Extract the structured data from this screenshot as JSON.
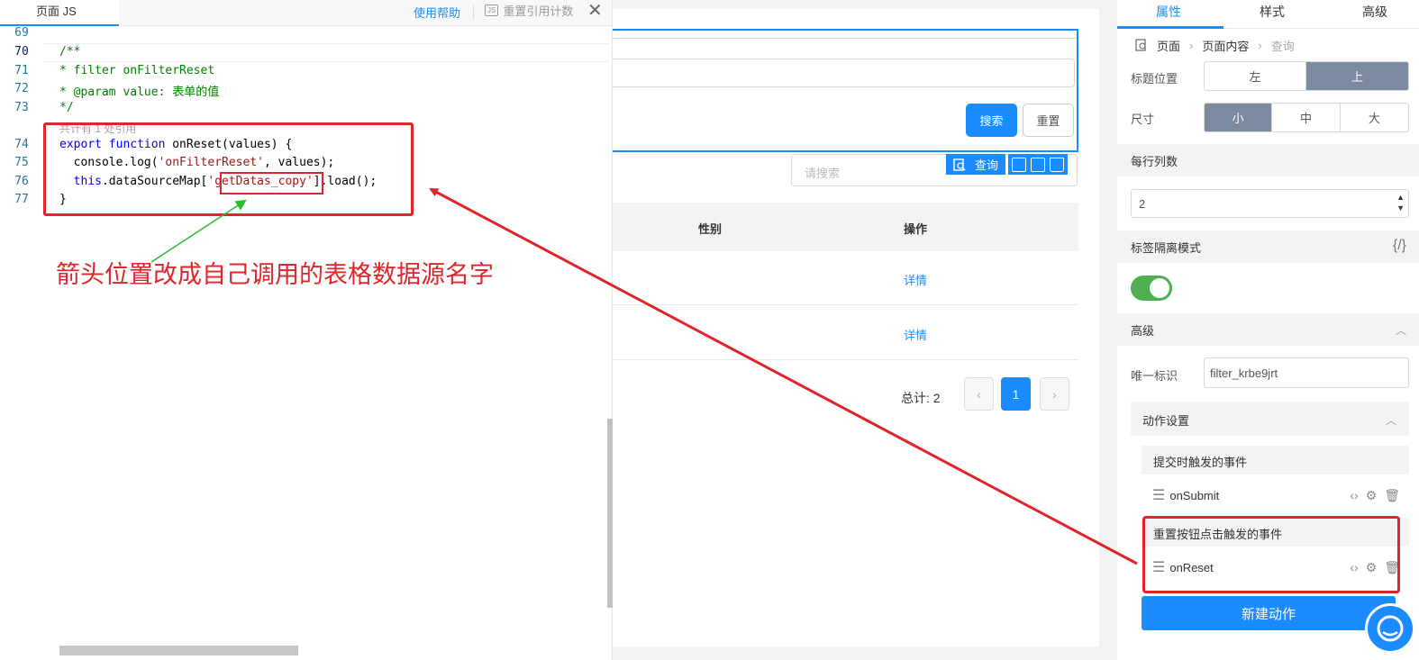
{
  "code_panel": {
    "tab_label": "页面 JS",
    "help_link": "使用帮助",
    "reset_ref_label": "重置引用计数",
    "js_badge": "JS",
    "close_glyph": "✕",
    "line_numbers": [
      "69",
      "70",
      "71",
      "72",
      "73",
      "74",
      "75",
      "76",
      "77"
    ],
    "codelens": "共计有 1 处引用",
    "code": {
      "l70": "/**",
      "l71": "* filter onFilterReset",
      "l72": "* @param value: 表单的值",
      "l73": "*/",
      "l74_kw": "export function",
      "l74_rest": " onReset(values) {",
      "l75_a": "  console.log(",
      "l75_str": "'onFilterReset'",
      "l75_b": ", values);",
      "l76_kw": "  this",
      "l76_a": ".dataSourceMap[",
      "l76_str": "'getDatas_copy'",
      "l76_b": "].load();",
      "l77": "}"
    },
    "annotation": "箭头位置改成自己调用的表格数据源名字"
  },
  "canvas": {
    "search_button": "搜索",
    "reset_button": "重置",
    "search_placeholder": "请搜索",
    "selected_component": "查询",
    "table_headers": {
      "gender": "性别",
      "action": "操作"
    },
    "rows": [
      {
        "action_link": "详情"
      },
      {
        "action_link": "详情"
      }
    ],
    "total": "总计: 2",
    "pagination": {
      "prev": "‹",
      "current": "1",
      "next": "›"
    }
  },
  "props": {
    "tabs": [
      "属性",
      "样式",
      "高级"
    ],
    "breadcrumb": [
      "页面",
      "页面内容",
      "查询"
    ],
    "label_position": {
      "label": "标题位置",
      "options": [
        "左",
        "上"
      ],
      "selected": "上"
    },
    "size": {
      "label": "尺寸",
      "options": [
        "小",
        "中",
        "大"
      ],
      "selected": "小"
    },
    "columns_per_row": {
      "label": "每行列数",
      "value": "2"
    },
    "label_isolation": {
      "label": "标签隔离模式",
      "enabled": true,
      "code_glyph": "{/}"
    },
    "advanced": {
      "label": "高级"
    },
    "unique_id": {
      "label": "唯一标识",
      "value": "filter_krbe9jrt"
    },
    "actions": {
      "label": "动作设置",
      "submit_event_title": "提交时触发的事件",
      "submit_handler": "onSubmit",
      "reset_event_title": "重置按钮点击触发的事件",
      "reset_handler": "onReset",
      "new_button": "新建动作"
    }
  },
  "colors": {
    "accent": "#1a8cff",
    "annotation_red": "#e0242b",
    "annotation_green": "#22c02a",
    "toggle_on": "#4caf50"
  }
}
